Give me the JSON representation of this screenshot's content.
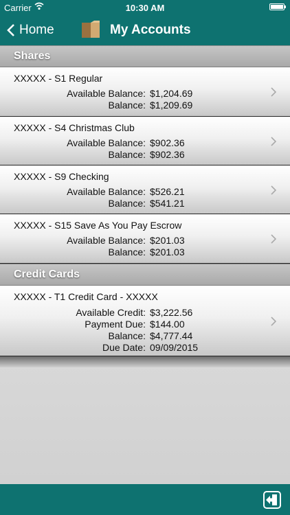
{
  "status": {
    "carrier": "Carrier",
    "time": "10:30 AM"
  },
  "nav": {
    "back_label": "Home",
    "title": "My Accounts"
  },
  "sections": [
    {
      "header": "Shares",
      "rows": [
        {
          "title": "XXXXX - S1 Regular",
          "lines": [
            {
              "k": "Available Balance:",
              "v": "$1,204.69"
            },
            {
              "k": "Balance:",
              "v": "$1,209.69"
            }
          ]
        },
        {
          "title": "XXXXX - S4 Christmas Club",
          "lines": [
            {
              "k": "Available Balance:",
              "v": "$902.36"
            },
            {
              "k": "Balance:",
              "v": "$902.36"
            }
          ]
        },
        {
          "title": "XXXXX - S9 Checking",
          "lines": [
            {
              "k": "Available Balance:",
              "v": "$526.21"
            },
            {
              "k": "Balance:",
              "v": "$541.21"
            }
          ]
        },
        {
          "title": "XXXXX - S15 Save As You Pay Escrow",
          "lines": [
            {
              "k": "Available Balance:",
              "v": "$201.03"
            },
            {
              "k": "Balance:",
              "v": "$201.03"
            }
          ]
        }
      ]
    },
    {
      "header": "Credit Cards",
      "rows": [
        {
          "title": "XXXXX - T1 Credit Card - XXXXX",
          "lines": [
            {
              "k": "Available Credit:",
              "v": "$3,222.56"
            },
            {
              "k": "Payment Due:",
              "v": "$144.00"
            },
            {
              "k": "Balance:",
              "v": "$4,777.44"
            },
            {
              "k": "Due Date:",
              "v": "09/09/2015"
            }
          ]
        }
      ]
    }
  ],
  "icons": {
    "back": "chevron-left-icon",
    "wallet": "wallet-icon",
    "row": "chevron-right-icon",
    "logout": "logout-icon"
  },
  "colors": {
    "bar": "#0e7270"
  }
}
